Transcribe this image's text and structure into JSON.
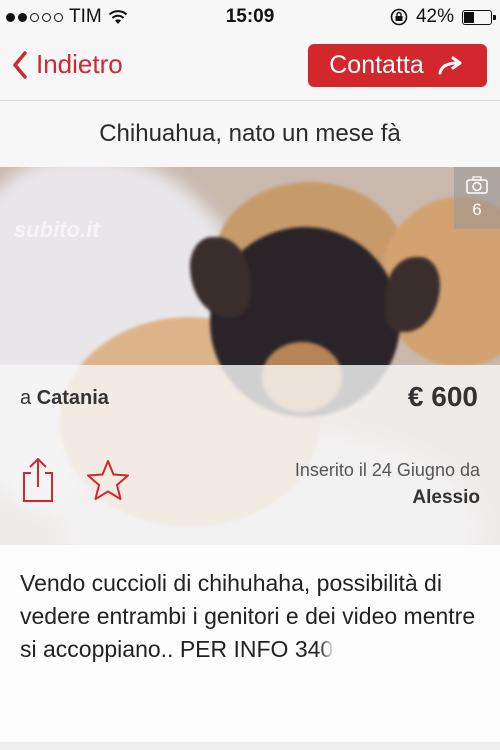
{
  "status_bar": {
    "carrier": "TIM",
    "time": "15:09",
    "battery_percent": "42%",
    "battery_level": 0.42
  },
  "nav": {
    "back_label": "Indietro",
    "contact_label": "Contatta"
  },
  "ad": {
    "title": "Chihuahua, nato un mese fà",
    "photo_count": "6",
    "watermark": "subito.it",
    "location_prefix": "a",
    "location": "Catania",
    "price": "€ 600",
    "inserted_text": "Inserito il 24 Giugno da",
    "user": "Alessio",
    "description": "Vendo cuccioli di chihuhaha, possibilità di vedere entrambi i genitori e dei video mentre si accoppiano.. PER INFO 340"
  },
  "colors": {
    "accent": "#d1272d",
    "background": "#f7f7f7"
  },
  "icons": [
    "wifi-icon",
    "lock-rotation-icon",
    "battery-icon",
    "back-chevron-icon",
    "arrow-right-icon",
    "camera-icon",
    "share-icon",
    "star-icon"
  ]
}
